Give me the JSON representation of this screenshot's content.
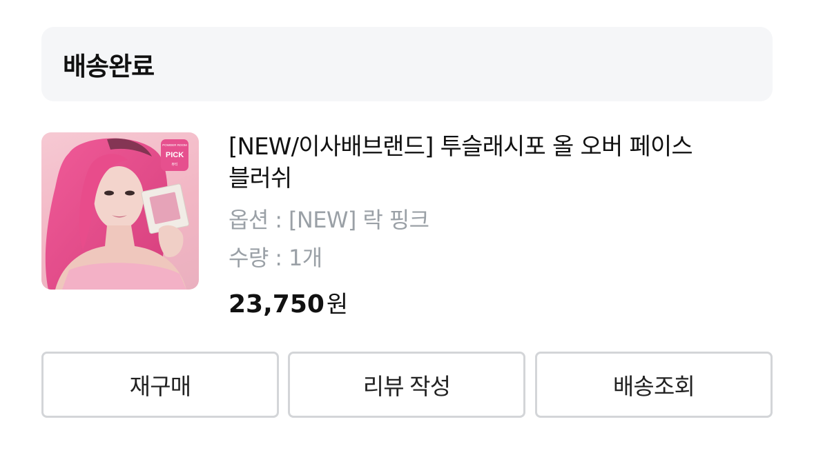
{
  "order": {
    "status": "배송완료"
  },
  "product": {
    "title": "[NEW/이사배브랜드] 투슬래시포 올 오버 페이스 블러쉬",
    "option": "옵션 : [NEW] 락 핑크",
    "quantity": "수량 : 1개",
    "price": "23,750",
    "price_unit": "원",
    "image_badge": {
      "top": "POWDER ROOM",
      "main": "PICK",
      "sub": "뷰티"
    }
  },
  "actions": {
    "rebuy": "재구매",
    "write_review": "리뷰 작성",
    "track_delivery": "배송조회"
  },
  "colors": {
    "status_bg": "#f5f6f8",
    "badge_pink": "#e6508e",
    "hair_pink": "#e84c8b",
    "muted_text": "#9aa0a6",
    "button_border": "#d3d5d8"
  }
}
